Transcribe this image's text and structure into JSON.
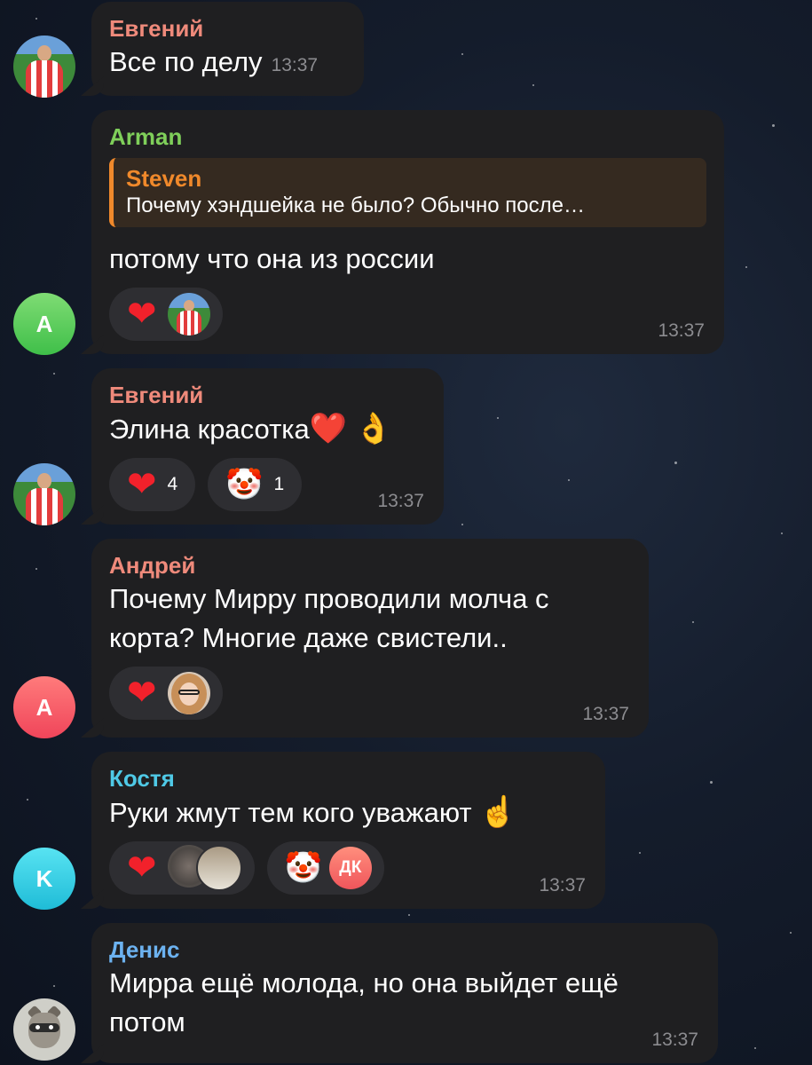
{
  "messages": [
    {
      "name": "Евгений",
      "name_color": "#ef8a7b",
      "text": "Все по делу",
      "time": "13:37",
      "avatar": "player-photo-icon"
    },
    {
      "name": "Arman",
      "name_color": "#7fcf5a",
      "reply_name": "Steven",
      "reply_text": "Почему хэндшейка не было? Обычно после…",
      "text": "потому что она из россии",
      "time": "13:37",
      "avatar_letter": "A"
    },
    {
      "name": "Евгений",
      "name_color": "#ef8a7b",
      "text": "Элина красотка",
      "emoji_heart": "❤️",
      "emoji_ok": "👌",
      "time": "13:37",
      "reaction_heart_count": "4",
      "reaction_clown_count": "1",
      "avatar": "player-photo-icon"
    },
    {
      "name": "Андрей",
      "name_color": "#ef8a7b",
      "text_line1": "Почему Мирру проводили молча с",
      "text_line2": "корта? Многие даже свистели..",
      "time": "13:37",
      "avatar_letter": "А"
    },
    {
      "name": "Костя",
      "name_color": "#4fc9e6",
      "text": "Руки жмут тем кого уважают",
      "emoji_point": "☝️",
      "time": "13:37",
      "avatar_letter": "K",
      "reaction_user_initials": "ДК"
    },
    {
      "name": "Денис",
      "name_color": "#6cb2f0",
      "text_line1": "Мирра ещё молода, но она выйдет ещё",
      "text_line2": "потом",
      "time": "13:37",
      "avatar": "raccoon-photo-icon"
    }
  ],
  "reaction_icons": {
    "heart": "❤",
    "clown": "🤡"
  },
  "colors": {
    "bubble": "#1f1f21",
    "pill": "#2e2e32",
    "time": "#8c8c90",
    "reply_accent": "#f0892b"
  }
}
